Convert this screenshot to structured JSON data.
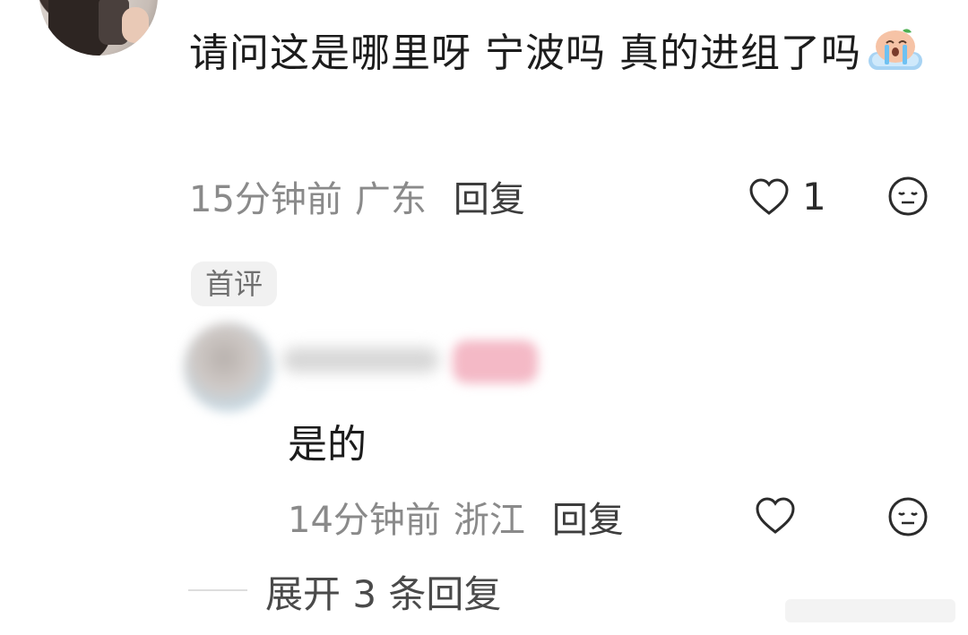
{
  "comment": {
    "text": "请问这是哪里呀 宁波吗 真的进组了吗",
    "time": "15分钟前",
    "location": "广东",
    "reply_label": "回复",
    "like_count": "1"
  },
  "first_comment_badge": "首评",
  "reply": {
    "text": "是的",
    "time": "14分钟前",
    "location": "浙江",
    "reply_label": "回复"
  },
  "expand_replies": "展开 3 条回复",
  "icons": {
    "like": "heart-outline-icon",
    "face": "neutral-face-icon",
    "emoji": "crying-peach-emoji"
  },
  "colors": {
    "text": "#1c1c1c",
    "meta": "#8a8a8a",
    "badge_bg": "#f1f1f1"
  }
}
